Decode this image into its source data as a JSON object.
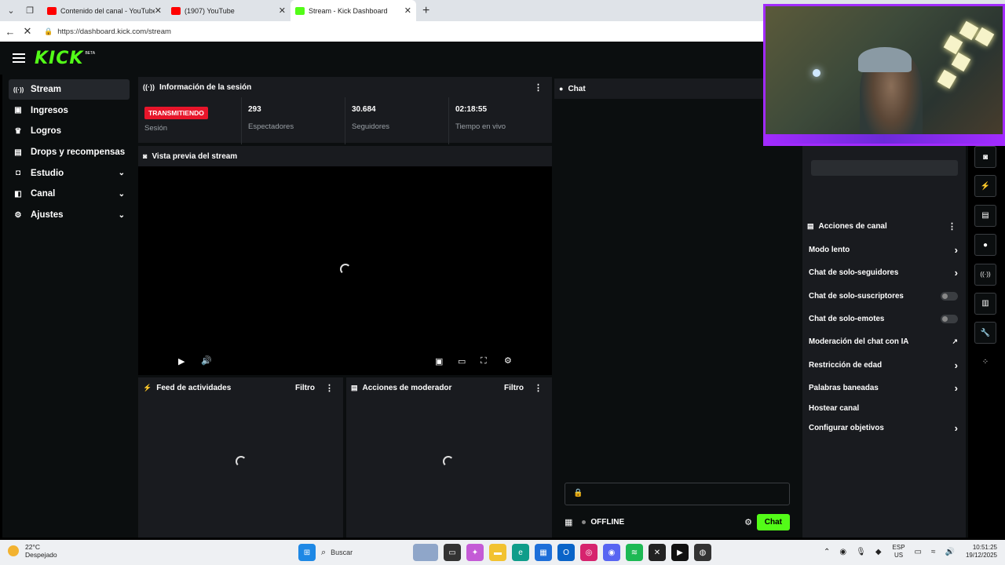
{
  "browser": {
    "tabs": [
      {
        "title": "Contenido del canal - YouTube Stu",
        "favicon_color": "#ff0000",
        "active": false
      },
      {
        "title": "(1907) YouTube",
        "favicon_color": "#ff0000",
        "active": false
      },
      {
        "title": "Stream - Kick Dashboard",
        "favicon_color": "#53fc18",
        "active": true
      }
    ],
    "url": "https://dashboard.kick.com/stream"
  },
  "header": {
    "logo": "KICK",
    "beta": "BETA"
  },
  "sidebar": {
    "items": [
      {
        "label": "Stream",
        "icon": "broadcast-icon",
        "glyph": "((·))",
        "active": true,
        "expandable": false
      },
      {
        "label": "Ingresos",
        "icon": "money-icon",
        "glyph": "▣",
        "active": false,
        "expandable": false
      },
      {
        "label": "Logros",
        "icon": "trophy-icon",
        "glyph": "🏆",
        "active": false,
        "expandable": false
      },
      {
        "label": "Drops y recompensas",
        "icon": "gift-icon",
        "glyph": "▤",
        "active": false,
        "expandable": false
      },
      {
        "label": "Estudio",
        "icon": "studio-icon",
        "glyph": "◘",
        "active": false,
        "expandable": true
      },
      {
        "label": "Canal",
        "icon": "channel-icon",
        "glyph": "◧",
        "active": false,
        "expandable": true
      },
      {
        "label": "Ajustes",
        "icon": "gear-icon",
        "glyph": "⚙",
        "active": false,
        "expandable": true
      }
    ]
  },
  "session": {
    "title": "Información de la sesión",
    "badge": "TRANSMITIENDO",
    "stats": [
      {
        "value": "",
        "label": "Sesión"
      },
      {
        "value": "293",
        "label": "Espectadores"
      },
      {
        "value": "30.684",
        "label": "Seguidores"
      },
      {
        "value": "02:18:55",
        "label": "Tiempo en vivo"
      }
    ]
  },
  "preview": {
    "title": "Vista previa del stream"
  },
  "activity": {
    "title": "Feed de actividades",
    "filter": "Filtro"
  },
  "moderator": {
    "title": "Acciones de moderador",
    "filter": "Filtro"
  },
  "chat": {
    "title": "Chat",
    "status": "OFFLINE",
    "button": "Chat"
  },
  "channel_actions": {
    "title": "Acciones de canal",
    "items": [
      {
        "label": "Modo lento",
        "control": "chevron"
      },
      {
        "label": "Chat de solo-seguidores",
        "control": "chevron"
      },
      {
        "label": "Chat de solo-suscriptores",
        "control": "toggle"
      },
      {
        "label": "Chat de solo-emotes",
        "control": "toggle"
      },
      {
        "label": "Moderación del chat con IA",
        "control": "external"
      },
      {
        "label": "Restricción de edad",
        "control": "chevron"
      },
      {
        "label": "Palabras baneadas",
        "control": "chevron"
      },
      {
        "label": "Hostear canal",
        "control": "none"
      },
      {
        "label": "Configurar objetivos",
        "control": "chevron"
      }
    ]
  },
  "taskbar": {
    "temp": "22°C",
    "weather": "Despejado",
    "search": "Buscar",
    "lang1": "ESP",
    "lang2": "US",
    "time": "10:51:25",
    "date": "19/12/2025"
  }
}
